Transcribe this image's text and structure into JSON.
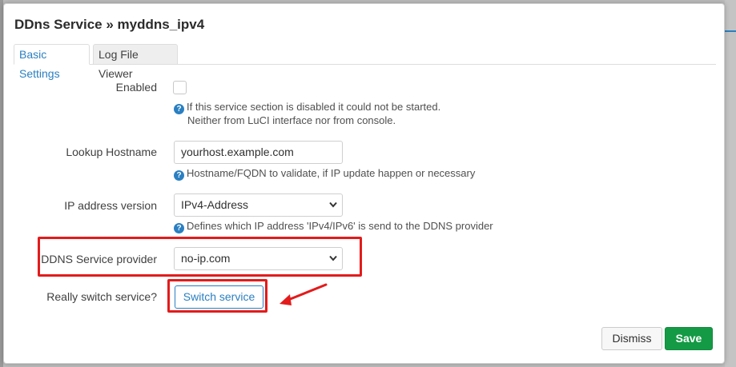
{
  "modal": {
    "title": "DDns Service » myddns_ipv4"
  },
  "tabs": [
    {
      "label": "Basic Settings",
      "active": true
    },
    {
      "label": "Log File Viewer",
      "active": false
    }
  ],
  "fields": {
    "enabled": {
      "label": "Enabled",
      "checked": false,
      "help_line1": "If this service section is disabled it could not be started.",
      "help_line2": "Neither from LuCI interface nor from console."
    },
    "lookup_hostname": {
      "label": "Lookup Hostname",
      "value": "yourhost.example.com",
      "help": "Hostname/FQDN to validate, if IP update happen or necessary"
    },
    "ip_version": {
      "label": "IP address version",
      "value": "IPv4-Address",
      "help": "Defines which IP address 'IPv4/IPv6' is send to the DDNS provider"
    },
    "service_provider": {
      "label": "DDNS Service provider",
      "value": "no-ip.com"
    },
    "switch_service": {
      "label": "Really switch service?",
      "button": "Switch service"
    }
  },
  "help_icon_glyph": "?",
  "footer": {
    "dismiss": "Dismiss",
    "save": "Save"
  },
  "colors": {
    "accent": "#2a7fc1",
    "save": "#149a45",
    "annotation": "#e31b1b"
  }
}
